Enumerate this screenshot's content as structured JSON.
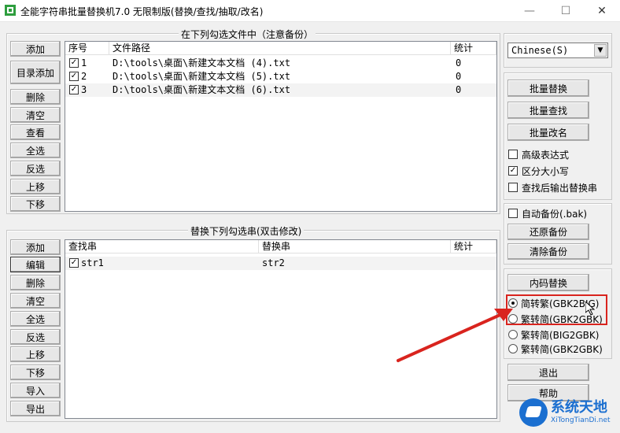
{
  "window": {
    "title": "全能字符串批量替换机7.0 无限制版(替换/查找/抽取/改名)",
    "min_glyph": "—",
    "max_glyph": "☐",
    "close_glyph": "✕"
  },
  "file_panel": {
    "group_label": "在下列勾选文件中（注意备份）",
    "buttons": [
      "添加",
      "目录添加",
      "删除",
      "清空",
      "查看",
      "全选",
      "反选",
      "上移",
      "下移"
    ],
    "columns": [
      "序号",
      "文件路径",
      "统计"
    ],
    "rows": [
      {
        "checked": true,
        "index": "1",
        "path": "D:\\tools\\桌面\\新建文本文档 (4).txt",
        "count": "0"
      },
      {
        "checked": true,
        "index": "2",
        "path": "D:\\tools\\桌面\\新建文本文档 (5).txt",
        "count": "0"
      },
      {
        "checked": true,
        "index": "3",
        "path": "D:\\tools\\桌面\\新建文本文档 (6).txt",
        "count": "0"
      }
    ]
  },
  "replace_panel": {
    "group_label": "替换下列勾选串(双击修改)",
    "buttons": [
      "添加",
      "编辑",
      "删除",
      "清空",
      "全选",
      "反选",
      "上移",
      "下移",
      "导入",
      "导出"
    ],
    "columns": [
      "查找串",
      "替换串",
      "统计"
    ],
    "rows": [
      {
        "checked": true,
        "find": "str1",
        "replace": "str2",
        "count": ""
      }
    ]
  },
  "right_panel": {
    "language": "Chinese(S)",
    "batch_replace": "批量替换",
    "batch_find": "批量查找",
    "batch_rename": "批量改名",
    "options": [
      {
        "label": "高级表达式",
        "checked": false
      },
      {
        "label": "区分大小写",
        "checked": true
      },
      {
        "label": "查找后输出替换串",
        "checked": false
      }
    ],
    "auto_backup": {
      "label": "自动备份(.bak)",
      "checked": false
    },
    "restore_backup": "还原备份",
    "clear_backup": "清除备份",
    "code_replace": "内码替换",
    "radios": [
      {
        "label": "简转繁(GBK2BIG)",
        "selected": true
      },
      {
        "label": "繁转简(GBK2GBK)",
        "selected": false
      },
      {
        "label": "繁转简(BIG2GBK)",
        "selected": false
      },
      {
        "label": "繁转简(GBK2GBK)",
        "selected": false
      }
    ],
    "exit": "退出",
    "help": "帮助"
  },
  "watermark": {
    "main": "系统天地",
    "sub": "XiTongTianDi.net"
  },
  "colors": {
    "highlight": "#d9241e",
    "watermark": "#1b6fd0"
  }
}
